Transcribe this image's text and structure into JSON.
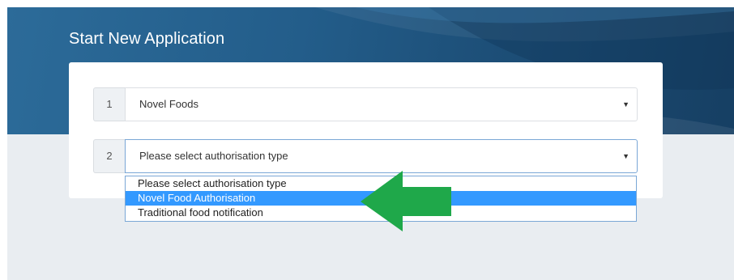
{
  "page": {
    "title": "Start New Application"
  },
  "form": {
    "steps": [
      {
        "number": "1",
        "value": "Novel Foods"
      },
      {
        "number": "2",
        "value": "Please select authorisation type"
      }
    ],
    "caret_icon": "caret-down-icon"
  },
  "dropdown": {
    "options": [
      "Please select authorisation type",
      "Novel Food Authorisation",
      "Traditional food notification"
    ],
    "highlighted_option": "Novel Food Authorisation"
  },
  "annotation": {
    "icon": "arrow-left-icon",
    "color": "#1fa84a"
  },
  "colors": {
    "header_bg": "#235d8a",
    "page_bg": "#e9edf1",
    "highlight": "#3399ff",
    "focus_border": "#7aa7d6"
  }
}
